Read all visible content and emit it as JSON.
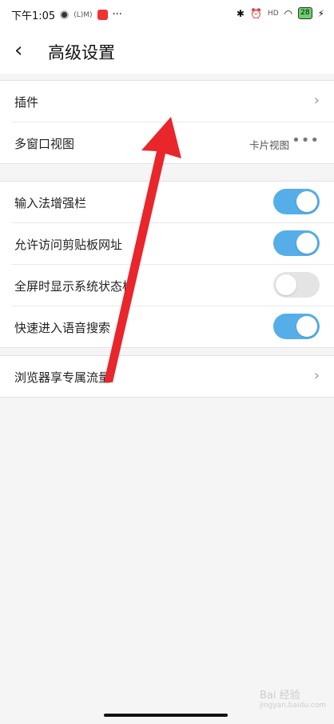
{
  "status_bar": {
    "time": "下午1:05",
    "badge_text": "(L)M)",
    "more": "···",
    "signal": "HD",
    "battery": "28"
  },
  "header": {
    "back_icon": "‹",
    "title": "高级设置"
  },
  "group1": [
    {
      "label": "插件",
      "chevron": "›"
    },
    {
      "label": "多窗口视图",
      "value": "卡片视图",
      "more": "•••"
    }
  ],
  "group2": [
    {
      "label": "输入法增强栏",
      "state": "on"
    },
    {
      "label": "允许访问剪贴板网址",
      "state": "on"
    },
    {
      "label": "全屏时显示系统状态栏",
      "state": "off"
    },
    {
      "label": "快速进入语音搜索",
      "state": "on"
    }
  ],
  "group3": [
    {
      "label": "浏览器享专属流量",
      "chevron": "›"
    }
  ],
  "watermark": {
    "line1": "Bai 经验",
    "line2": "jingyan.baidu.com"
  },
  "colors": {
    "toggle_on": "#56aee8",
    "arrow": "#e8262c"
  }
}
